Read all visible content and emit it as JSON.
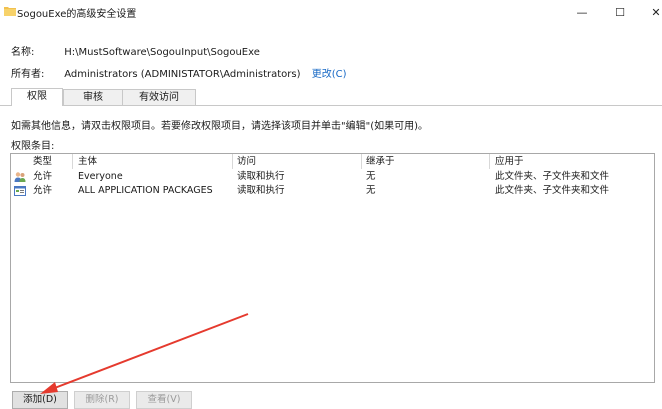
{
  "window": {
    "title": "SogouExe的高级安全设置",
    "controls": {
      "minimize": "—",
      "maximize": "☐",
      "close": "✕"
    }
  },
  "info": {
    "name_label": "名称:",
    "name_value": "H:\\MustSoftware\\SogouInput\\SogouExe",
    "owner_label": "所有者:",
    "owner_value": "Administrators (ADMINISTATOR\\Administrators)",
    "change_link": "更改(C)"
  },
  "tabs": [
    {
      "label": "权限",
      "active": true
    },
    {
      "label": "审核",
      "active": false
    },
    {
      "label": "有效访问",
      "active": false
    }
  ],
  "description": "如需其他信息，请双击权限项目。若要修改权限项目，请选择该项目并单击\"编辑\"(如果可用)。",
  "entries_label": "权限条目:",
  "table": {
    "headers": [
      "类型",
      "主体",
      "访问",
      "继承于",
      "应用于"
    ],
    "rows": [
      {
        "icon": "users-icon",
        "type": "允许",
        "principal": "Everyone",
        "access": "读取和执行",
        "inherited": "无",
        "applies": "此文件夹、子文件夹和文件"
      },
      {
        "icon": "app-packages-icon",
        "type": "允许",
        "principal": "ALL APPLICATION PACKAGES",
        "access": "读取和执行",
        "inherited": "无",
        "applies": "此文件夹、子文件夹和文件"
      }
    ]
  },
  "buttons": {
    "add": "添加(D)",
    "remove": "删除(R)",
    "view": "查看(V)"
  },
  "colors": {
    "link": "#1668c5",
    "annotation_arrow": "#e53a2e"
  }
}
